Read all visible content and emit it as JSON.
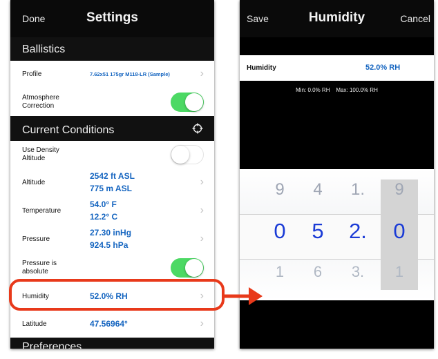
{
  "left_screen": {
    "nav": {
      "done_label": "Done",
      "title": "Settings"
    },
    "sections": {
      "ballistics": "Ballistics",
      "current_conditions": "Current Conditions",
      "preferences": "Preferences"
    },
    "rows": {
      "profile": {
        "label": "Profile",
        "value": "7.62x51 175gr M118-LR (Sample)"
      },
      "atmosphere": {
        "label_1": "Atmosphere",
        "label_2": "Correction",
        "on": true
      },
      "density": {
        "label_1": "Use Density",
        "label_2": "Altitude",
        "on": false
      },
      "altitude": {
        "label": "Altitude",
        "value_1": "2542 ft ASL",
        "value_2": "775 m ASL"
      },
      "temperature": {
        "label": "Temperature",
        "value_1": "54.0° F",
        "value_2": "12.2° C"
      },
      "pressure": {
        "label": "Pressure",
        "value_1": "27.30 inHg",
        "value_2": "924.5 hPa"
      },
      "pressure_absolute": {
        "label_1": "Pressure is",
        "label_2": "absolute",
        "on": true
      },
      "humidity": {
        "label": "Humidity",
        "value": "52.0% RH"
      },
      "latitude": {
        "label": "Latitude",
        "value": "47.56964°"
      }
    },
    "chevron": "›"
  },
  "right_screen": {
    "nav": {
      "save_label": "Save",
      "title": "Humidity",
      "cancel_label": "Cancel"
    },
    "field": {
      "label": "Humidity",
      "value": "52.0% RH"
    },
    "range": {
      "min": "Min: 0.0% RH",
      "max": "Max: 100.0% RH"
    },
    "picker": {
      "columns": [
        {
          "top": "9",
          "selected": "0",
          "bottom": "1"
        },
        {
          "top": "4",
          "selected": "5",
          "bottom": "6"
        },
        {
          "top": "1.",
          "selected": "2.",
          "bottom": "3."
        },
        {
          "top": "9",
          "selected": "0",
          "bottom": "1"
        }
      ]
    }
  },
  "colors": {
    "accent_blue": "#1565c0",
    "toggle_on": "#4cd964",
    "highlight_red": "#e8391a",
    "picker_selected": "#1a3bd6"
  },
  "icons": {
    "locate": "crosshair-icon",
    "chevron": "chevron-right-icon",
    "arrow": "arrow-right-icon"
  }
}
